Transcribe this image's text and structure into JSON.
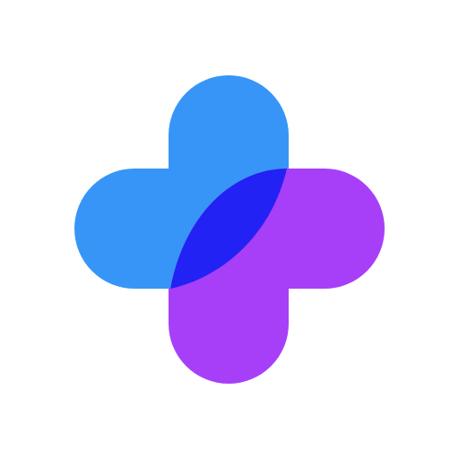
{
  "logo": {
    "icon": "plus-cross-logo-icon",
    "colors": {
      "background": "#ffffff",
      "blue": "#3795f7",
      "purple": "#a73ff8",
      "overlap": "#2222f4"
    }
  }
}
